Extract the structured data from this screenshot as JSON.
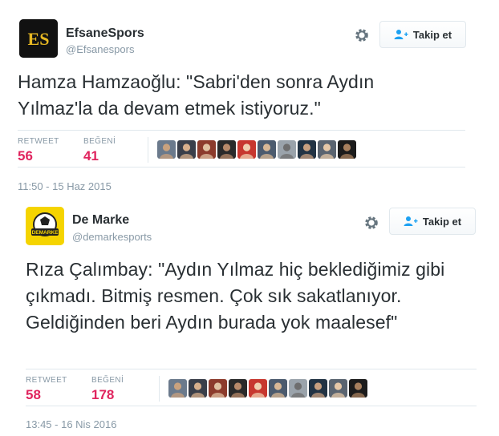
{
  "tweets": [
    {
      "name": "EfsaneSpors",
      "handle": "@Efsanespors",
      "avatar_text": "ES",
      "follow_label": "Takip et",
      "text": "Hamza Hamzaoğlu: \"Sabri'den sonra Aydın Yılmaz'la da devam etmek istiyoruz.\"",
      "retweet_label": "RETWEET",
      "retweet_count": "56",
      "like_label": "BEĞENİ",
      "like_count": "41",
      "timestamp": "11:50 - 15 Haz 2015"
    },
    {
      "name": "De Marke",
      "handle": "@demarkesports",
      "avatar_text": "DEMARKE",
      "follow_label": "Takip et",
      "text": "Rıza Çalımbay: \"Aydın Yılmaz hiç beklediğimiz gibi çıkmadı. Bitmiş resmen. Çok sık sakatlanıyor. Geldiğinden beri Aydın burada yok maalesef\"",
      "retweet_label": "RETWEET",
      "retweet_count": "58",
      "like_label": "BEĞENİ",
      "like_count": "178",
      "timestamp": "13:45 - 16 Nis 2016"
    }
  ],
  "colors": {
    "count": "#e0245e",
    "muted": "#8899a6",
    "text": "#292f33",
    "border": "#e1e8ed",
    "avatar1_bg": "#111111",
    "avatar1_fg": "#e8b923",
    "avatar2_bg": "#f5d400"
  },
  "icons": {
    "settings": "gear-icon",
    "follow": "add-person-icon"
  },
  "liker_faces_1": [
    "face",
    "face",
    "face",
    "face",
    "face",
    "face",
    "face",
    "face",
    "face",
    "face"
  ],
  "liker_faces_2": [
    "face",
    "face",
    "face",
    "face",
    "face",
    "face",
    "face",
    "face",
    "face",
    "face"
  ]
}
